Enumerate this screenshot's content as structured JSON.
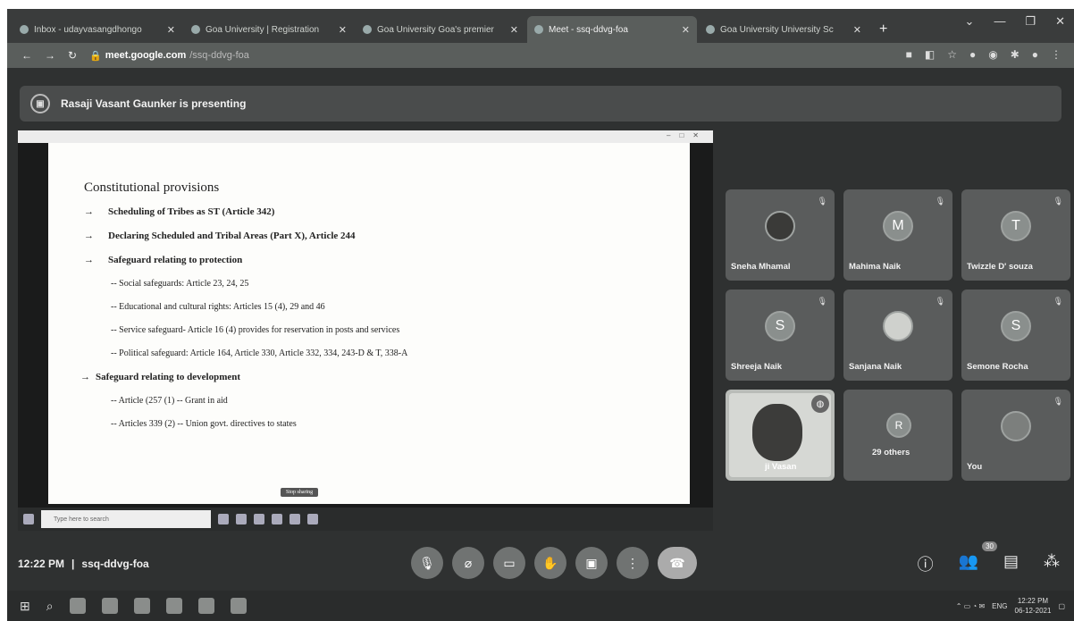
{
  "browser": {
    "tabs": [
      {
        "title": "Inbox - udayvasangdhongo"
      },
      {
        "title": "Goa University | Registration"
      },
      {
        "title": "Goa University Goa's premier"
      },
      {
        "title": "Meet - ssq-ddvg-foa",
        "active": true
      },
      {
        "title": "Goa University University Sc"
      }
    ],
    "url_host": "meet.google.com",
    "url_path": "/ssq-ddvg-foa"
  },
  "meet": {
    "presenting_text": "Rasaji Vasant Gaunker is presenting",
    "meeting_time": "12:22 PM",
    "separator": "|",
    "meeting_code": "ssq-ddvg-foa",
    "participant_badge": "30",
    "participants": [
      {
        "name": "Sneha Mhamal",
        "initial": ""
      },
      {
        "name": "Mahima Naik",
        "initial": "M"
      },
      {
        "name": "Twizzle D' souza",
        "initial": "T"
      },
      {
        "name": "Shreeja Naik",
        "initial": "S"
      },
      {
        "name": "Sanjana Naik",
        "initial": ""
      },
      {
        "name": "Semone Rocha",
        "initial": "S"
      },
      {
        "name": "ji Vasan",
        "initial": ""
      },
      {
        "name": "29 others",
        "initial": "R"
      },
      {
        "name": "You",
        "initial": ""
      }
    ]
  },
  "slide": {
    "title": "Constitutional provisions",
    "lines": [
      {
        "kind": "bullet",
        "marker": "→",
        "text": "Scheduling of Tribes as ST (Article 342)"
      },
      {
        "kind": "bullet",
        "marker": "→",
        "text": "Declaring Scheduled and Tribal Areas (Part X), Article 244"
      },
      {
        "kind": "bullet",
        "marker": "→",
        "text": "Safeguard relating to protection"
      },
      {
        "kind": "sub",
        "text": "-- Social safeguards: Article 23, 24, 25"
      },
      {
        "kind": "sub",
        "text": "-- Educational and cultural rights: Articles 15 (4), 29 and 46"
      },
      {
        "kind": "sub",
        "text": "-- Service safeguard- Article 16 (4) provides for reservation in posts and services"
      },
      {
        "kind": "sub",
        "text": "-- Political safeguard: Article 164, Article 330, Article 332, 334, 243-D & T, 338-A"
      },
      {
        "kind": "bullet",
        "marker": "→",
        "text": "Safeguard relating to development"
      },
      {
        "kind": "sub",
        "text": "-- Article (257 (1) -- Grant in aid"
      },
      {
        "kind": "sub",
        "text": "-- Articles 339 (2) -- Union govt. directives to states"
      }
    ],
    "share_stop_label": "Stop sharing",
    "search_placeholder": "Type here to search"
  },
  "taskbar": {
    "time": "12:22 PM",
    "date": "06-12-2021",
    "lang": "ENG"
  },
  "colors": {
    "meet_bg": "#2f3131",
    "tile_bg": "#5a5c5c",
    "end_call": "#ababab"
  }
}
